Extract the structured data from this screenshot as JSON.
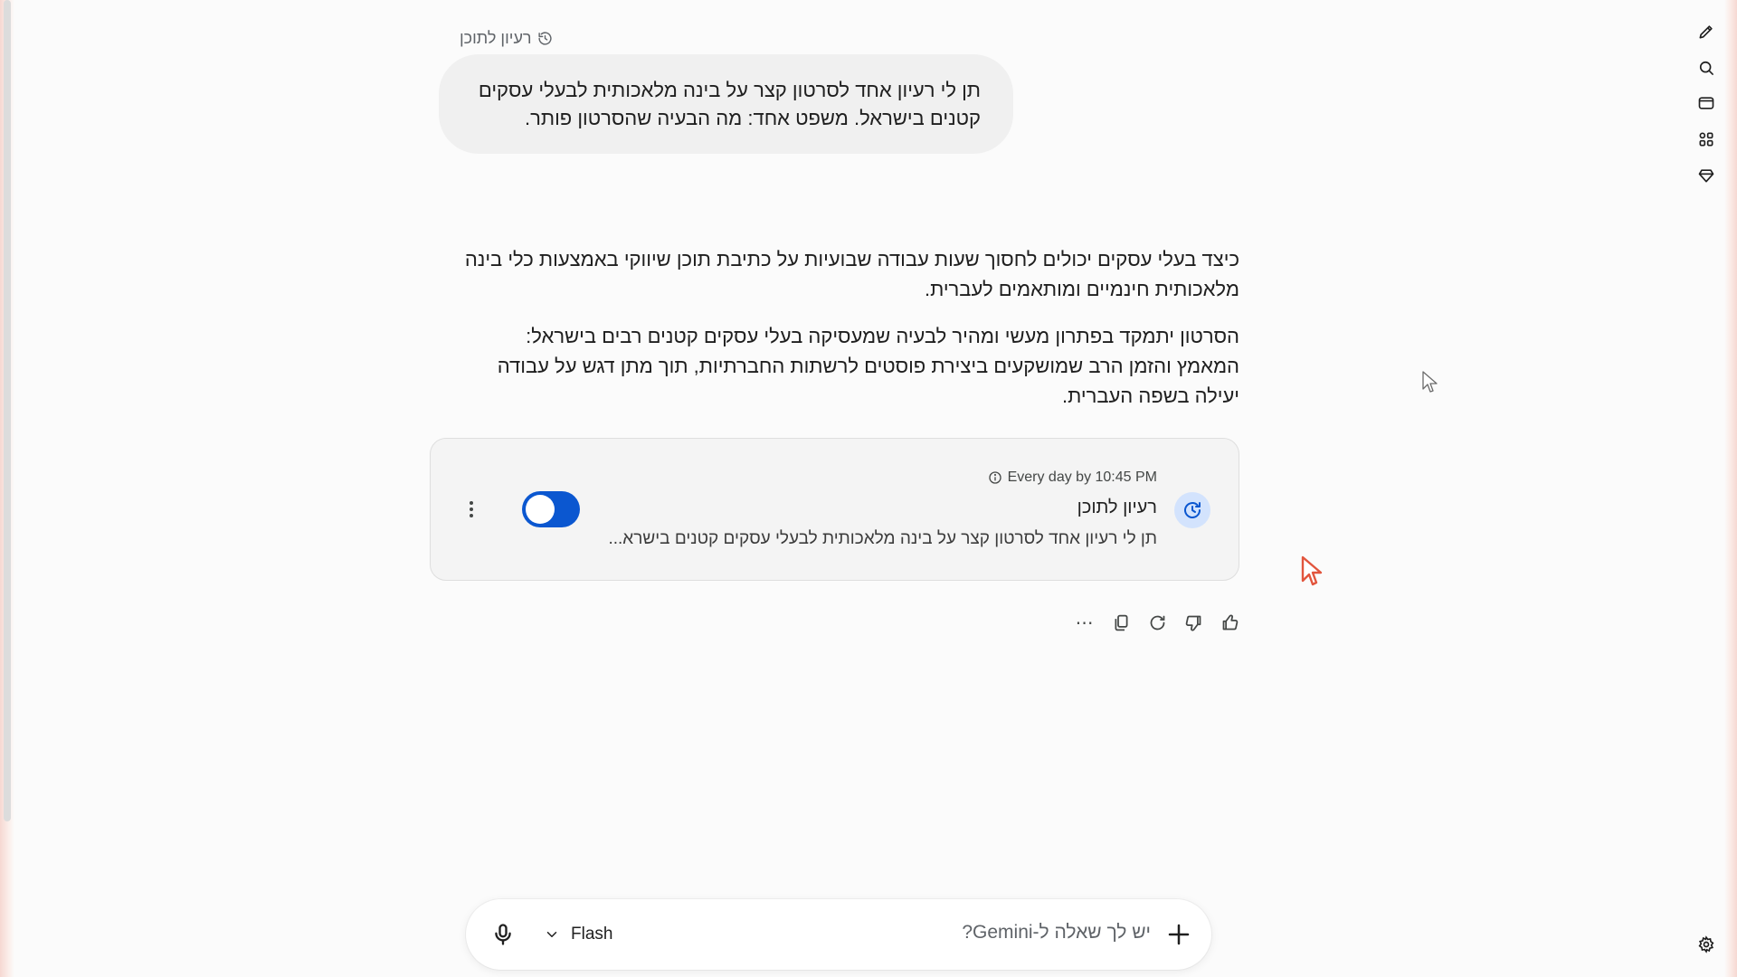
{
  "user_prompt": {
    "label": "רעיון לתוכן",
    "text": "תן לי רעיון אחד לסרטון קצר על בינה מלאכותית לבעלי עסקים קטנים בישראל. משפט אחד: מה הבעיה שהסרטון פותר."
  },
  "response": {
    "paragraphs": [
      "כיצד בעלי עסקים יכולים לחסוך שעות עבודה שבועיות על כתיבת תוכן שיווקי באמצעות כלי בינה מלאכותית חינמיים ומותאמים לעברית.",
      "הסרטון יתמקד בפתרון מעשי ומהיר לבעיה שמעסיקה בעלי עסקים קטנים רבים בישראל: המאמץ והזמן הרב שמושקעים ביצירת פוסטים לרשתות החברתיות, תוך מתן דגש על עבודה יעילה בשפה העברית."
    ]
  },
  "scheduled_action": {
    "schedule": "Every day by 10:45 PM",
    "title": "רעיון לתוכן",
    "description": "תן לי רעיון אחד לסרטון קצר על בינה מלאכותית לבעלי עסקים קטנים בישרא...",
    "enabled": true,
    "icon": "schedule-clock-icon"
  },
  "response_actions": [
    {
      "name": "more-options-icon",
      "glyph": "⋯"
    },
    {
      "name": "copy-icon"
    },
    {
      "name": "regenerate-icon"
    },
    {
      "name": "thumbs-down-icon"
    },
    {
      "name": "thumbs-up-icon"
    }
  ],
  "input": {
    "placeholder": "יש לך שאלה ל-Gemini?",
    "model": "Flash"
  },
  "right_rail": [
    "edit-icon",
    "search-icon",
    "chat-icon",
    "apps-icon",
    "gem-icon",
    "settings-icon"
  ],
  "colors": {
    "accent": "#0b57d0",
    "icon_bg": "#d3e3fd",
    "bubble": "#f0f0f0",
    "card": "#f4f4f4"
  }
}
